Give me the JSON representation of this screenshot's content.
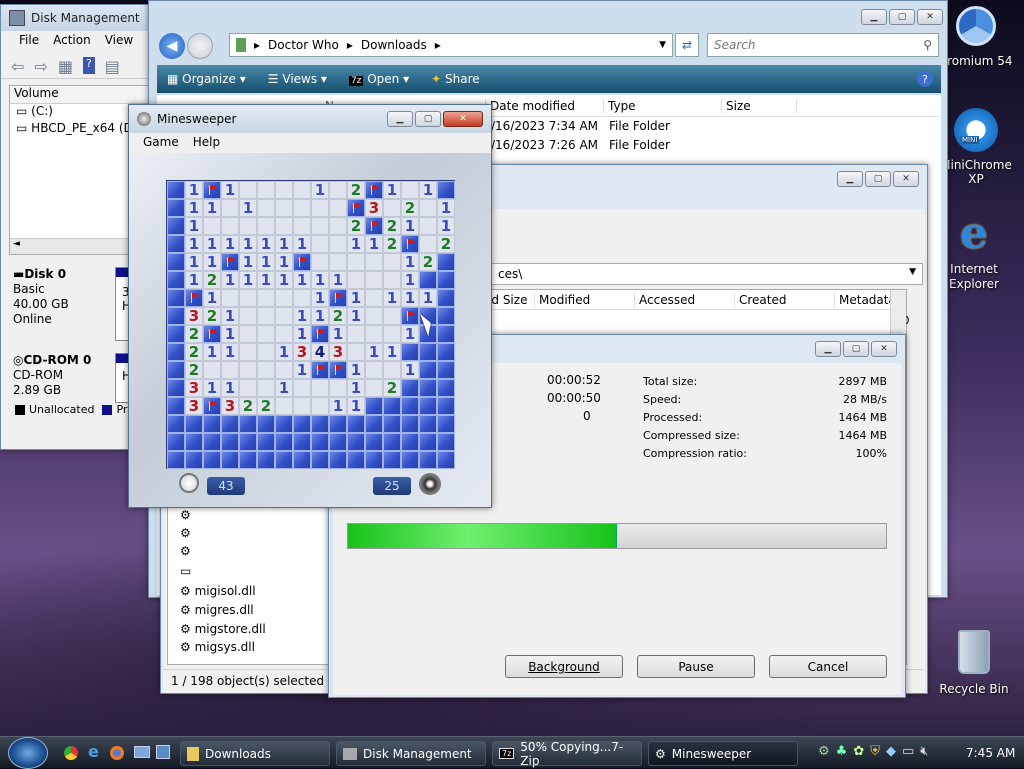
{
  "desktop": {
    "icons": [
      {
        "label": "hromium 54"
      },
      {
        "label": "MiniChrome XP"
      },
      {
        "label": "Internet Explorer"
      },
      {
        "label": "Recycle Bin"
      }
    ]
  },
  "disk_mgmt": {
    "title": "Disk Management",
    "menu": [
      "File",
      "Action",
      "View",
      "H"
    ],
    "col_volume": "Volume",
    "volumes": [
      "(C:)",
      "HBCD_PE_x64 (D:)"
    ],
    "disk0": {
      "name": "Disk 0",
      "type": "Basic",
      "size": "40.00 GB",
      "status": "Online",
      "clip": "3",
      "clip2": "H"
    },
    "cdrom0": {
      "name": "CD-ROM 0",
      "type": "CD-ROM",
      "size": "2.89 GB",
      "clip": "H"
    },
    "legend": {
      "unalloc": "Unallocated",
      "primary": "Prim"
    }
  },
  "explorer": {
    "breadcrumb": [
      "Doctor Who",
      "Downloads"
    ],
    "search_placeholder": "Search",
    "toolbar": {
      "organize": "Organize",
      "views": "Views",
      "open": "Open",
      "share": "Share"
    },
    "columns": {
      "name": "N",
      "date": "Date modified",
      "type": "Type",
      "size": "Size"
    },
    "rows": [
      {
        "date": "/16/2023 7:34 AM",
        "type": "File Folder"
      },
      {
        "date": "/16/2023 7:26 AM",
        "type": "File Folder"
      }
    ]
  },
  "zip_fm": {
    "path": "ces\\",
    "columns": {
      "size": "ed Size",
      "modified": "Modified",
      "accessed": "Accessed",
      "created": "Created",
      "meta": "Metadata Ch"
    },
    "meta_cell": "6.0",
    "files": [
      "migisol.dll",
      "migres.dll",
      "migstore.dll",
      "migsys.dll"
    ],
    "status": "1 / 198 object(s) selected"
  },
  "zip_progress": {
    "elapsed": "00:00:52",
    "remaining": "00:00:50",
    "files": "0",
    "stats": [
      {
        "label": "Total size:",
        "value": "2897 MB"
      },
      {
        "label": "Speed:",
        "value": "28 MB/s"
      },
      {
        "label": "Processed:",
        "value": "1464 MB"
      },
      {
        "label": "Compressed size:",
        "value": "1464 MB"
      },
      {
        "label": "Compression ratio:",
        "value": "100%"
      }
    ],
    "progress": 0.5,
    "buttons": {
      "background": "Background",
      "pause": "Pause",
      "cancel": "Cancel"
    }
  },
  "minesweeper": {
    "title": "Minesweeper",
    "menu": {
      "game": "Game",
      "help": "Help"
    },
    "timer": "43",
    "mines_left": "25",
    "board": [
      "#1F1....1.2F1.1#",
      "#11.1.....F3.2.1#",
      "#1........2F21.1#",
      "#1111111..112F.2#",
      "#11F111F.....12#",
      "#121111111...1#",
      "#F1.....1F1.111#",
      "#321...1121..F##",
      "#2F1...1F1...1###",
      "#211..1343.11####",
      "#2.....1FF1..1####",
      "#311..1...1.2####",
      "#3F322...11######",
      "################",
      "################",
      "################"
    ]
  },
  "taskbar": {
    "items": [
      {
        "label": "Downloads"
      },
      {
        "label": "Disk Management"
      },
      {
        "label": "50% Copying...7-Zip"
      },
      {
        "label": "Minesweeper"
      }
    ],
    "clock": "7:45 AM"
  }
}
